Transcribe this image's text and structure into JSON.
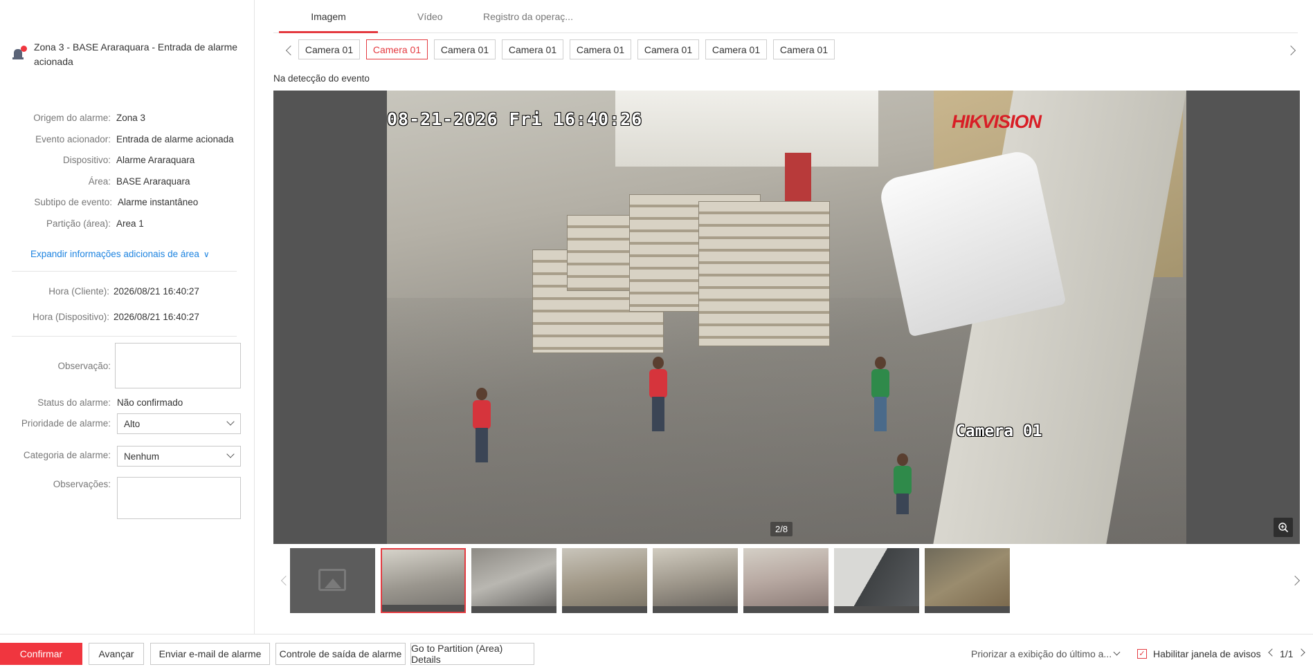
{
  "alarm": {
    "title": "Zona 3 - BASE Araraquara - Entrada de alarme acionada"
  },
  "details": {
    "origin_label": "Origem do alarme:",
    "origin_value": "Zona 3",
    "event_label": "Evento acionador:",
    "event_value": "Entrada de alarme acionada",
    "device_label": "Dispositivo:",
    "device_value": "Alarme Araraquara",
    "area_label": "Área:",
    "area_value": "BASE Araraquara",
    "subtype_label": "Subtipo de evento:",
    "subtype_value": "Alarme instantâneo",
    "partition_label": "Partição (área):",
    "partition_value": "Area 1",
    "expand_label": "Expandir informações adicionais de área"
  },
  "times": {
    "client_label": "Hora (Cliente):",
    "client_value": "2026/08/21 16:40:27",
    "device_label": "Hora (Dispositivo):",
    "device_value": "2026/08/21 16:40:27"
  },
  "form": {
    "observation_label": "Observação:",
    "status_label": "Status do alarme:",
    "status_value": "Não confirmado",
    "priority_label": "Prioridade de alarme:",
    "priority_value": "Alto",
    "category_label": "Categoria de alarme:",
    "category_value": "Nenhum",
    "remarks_label": "Observações:"
  },
  "tabs": [
    "Imagem",
    "Vídeo",
    "Registro da operaç..."
  ],
  "active_tab": 0,
  "cameras": [
    "Camera 01",
    "Camera 01",
    "Camera 01",
    "Camera 01",
    "Camera 01",
    "Camera 01",
    "Camera 01",
    "Camera 01"
  ],
  "active_camera": 1,
  "viewer": {
    "event_label": "Na detecção do evento",
    "osd_time": "08-21-2026 Fri 16:40:26",
    "osd_brand": "HIKVISION",
    "osd_camera": "Camera 01",
    "counter": "2/8"
  },
  "thumbnails": {
    "count": 8,
    "active": 1
  },
  "footer": {
    "confirm": "Confirmar",
    "advance": "Avançar",
    "email": "Enviar e-mail de alarme",
    "output": "Controle de saída de alarme",
    "partition": "Go to Partition (Area) Details",
    "prioritize": "Priorizar a exibição do último a...",
    "popup_label": "Habilitar janela de avisos",
    "popup_checked": true,
    "page": "1/1"
  },
  "colors": {
    "accent": "#e43a40",
    "confirm_bg": "#f0363f",
    "link": "#1c83e0"
  }
}
